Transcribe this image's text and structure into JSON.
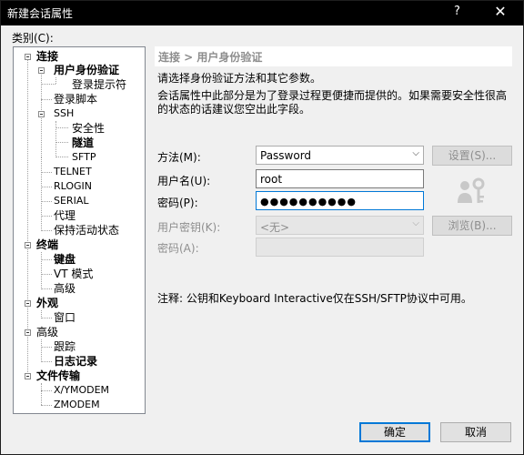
{
  "window": {
    "title": "新建会话属性",
    "help_glyph": "?",
    "close_glyph": "✕"
  },
  "category_label": "类别(C):",
  "tree": {
    "connection": "连接",
    "auth": "用户身份验证",
    "login_prompt": "登录提示符",
    "login_script": "登录脚本",
    "ssh": "SSH",
    "security": "安全性",
    "tunnel": "隧道",
    "sftp": "SFTP",
    "telnet": "TELNET",
    "rlogin": "RLOGIN",
    "serial": "SERIAL",
    "proxy": "代理",
    "keepalive": "保持活动状态",
    "terminal": "终端",
    "keyboard": "键盘",
    "vt_mode": "VT 模式",
    "terminal_advanced": "高级",
    "appearance": "外观",
    "window": "窗口",
    "advanced": "高级",
    "trace": "跟踪",
    "log": "日志记录",
    "file_transfer": "文件传输",
    "xymodem": "X/YMODEM",
    "zmodem": "ZMODEM"
  },
  "panel": {
    "header": "连接 > 用户身份验证",
    "desc1": "请选择身份验证方法和其它参数。",
    "desc2": "会话属性中此部分是为了登录过程更便捷而提供的。如果需要安全性很高",
    "desc3": "的状态的话建议您空出此字段。",
    "method_label": "方法(M):",
    "method_value": "Password",
    "settings_button": "设置(S)...",
    "username_label": "用户名(U):",
    "username_value": "root",
    "password_label": "密码(P):",
    "password_value": "●●●●●●●●●●",
    "userkey_label": "用户密钥(K):",
    "userkey_value": "<无>",
    "browse_button": "浏览(B)...",
    "passphrase_label": "密码(A):",
    "passphrase_value": "",
    "note": "注释: 公钥和Keyboard Interactive仅在SSH/SFTP协议中可用。"
  },
  "footer": {
    "ok": "确定",
    "cancel": "取消"
  }
}
